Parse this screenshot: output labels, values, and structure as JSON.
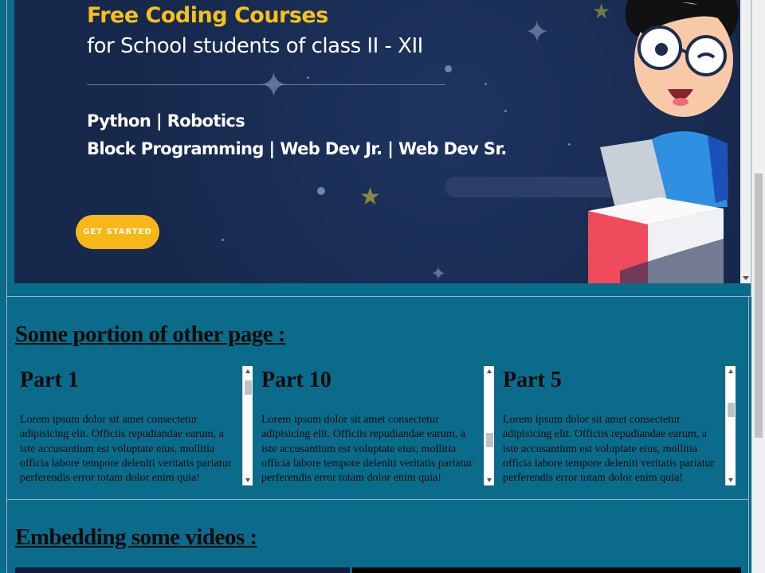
{
  "banner": {
    "title": "Free Coding Courses",
    "subtitle": "for School students of class II - XII",
    "courses_line1": "Python | Robotics",
    "courses_line2": "Block Programming | Web Dev Jr. | Web Dev Sr.",
    "cta_label": "GET STARTED"
  },
  "other_page": {
    "heading": "Some portion of other page :",
    "parts": [
      {
        "title": "Part 1",
        "text": "Lorem ipsum dolor sit amet consectetur adipisicing elit. Officiis repudiandae earum, a iste accusantium est voluptate eius, mollitia officia labore tempore deleniti veritatis pariatur perferendis error totam dolor enim quia!"
      },
      {
        "title": "Part 10",
        "text": "Lorem ipsum dolor sit amet consectetur adipisicing elit. Officiis repudiandae earum, a iste accusantium est voluptate eius, mollitia officia labore tempore deleniti veritatis pariatur perferendis error totam dolor enim quia!"
      },
      {
        "title": "Part 5",
        "text": "Lorem ipsum dolor sit amet consectetur adipisicing elit. Officiis repudiandae earum, a iste accusantium est voluptate eius, mollitia officia labore tempore deleniti veritatis pariatur perferendis error totam dolor enim quia!"
      }
    ]
  },
  "videos": {
    "heading": "Embedding some videos :"
  },
  "colors": {
    "page_bg": "#0a6b8a",
    "banner_bg": "#172a4e",
    "accent_yellow": "#f7c11b"
  }
}
